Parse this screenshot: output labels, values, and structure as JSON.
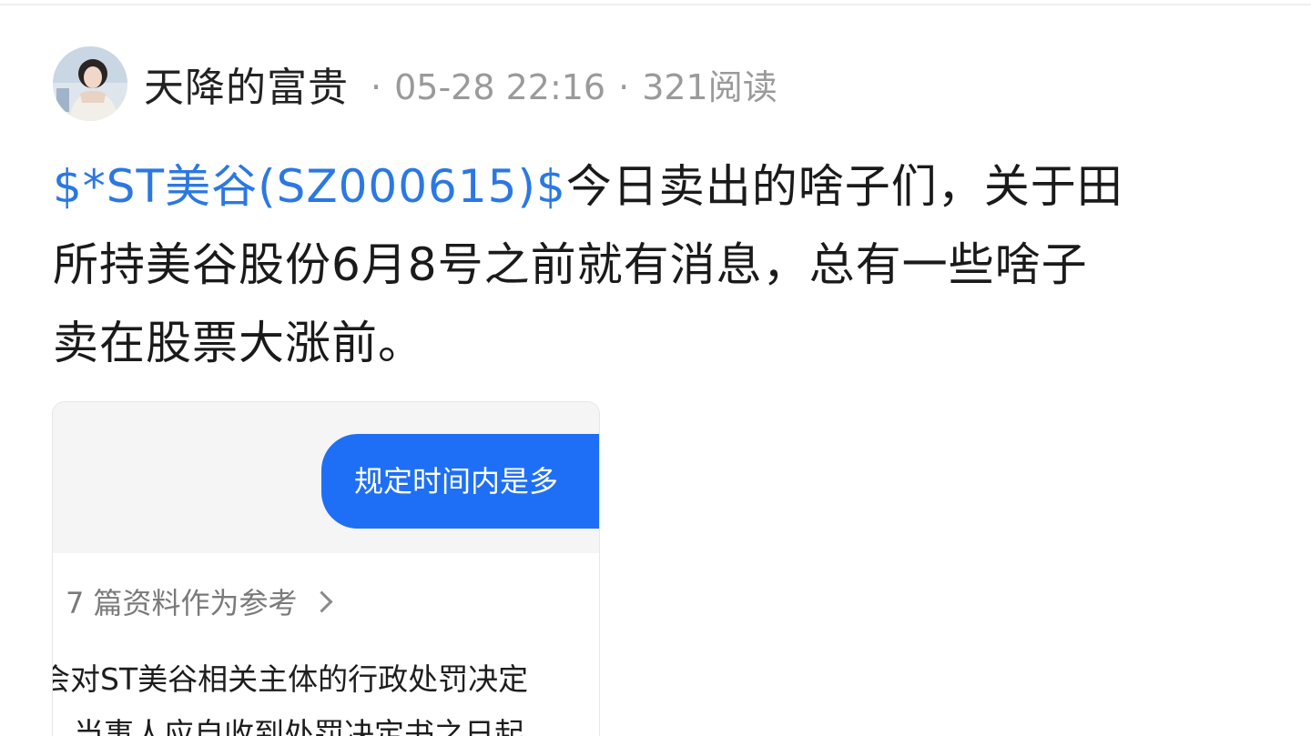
{
  "post": {
    "author": "天降的富贵",
    "time": "05-28 22:16",
    "reads": "321阅读",
    "body": {
      "stock_tag": "$*ST美谷(SZ000615)$",
      "line1_rest": "今日卖出的啥子们，关于田",
      "line2": "所持美谷股份6月8号之前就有消息，总有一些啥子",
      "line3": "卖在股票大涨前。"
    }
  },
  "card": {
    "bubble_text": "规定时间内是多",
    "refs_label": "7 篇资料作为参考",
    "text_line1": "会对ST美谷相关主体的行政处罚决定",
    "text_line2": "，当事人应自收到处罚决定书之日起"
  },
  "colors": {
    "link": "#2b78e4",
    "bubble": "#1e6ff5",
    "meta": "#9a9a9a"
  }
}
